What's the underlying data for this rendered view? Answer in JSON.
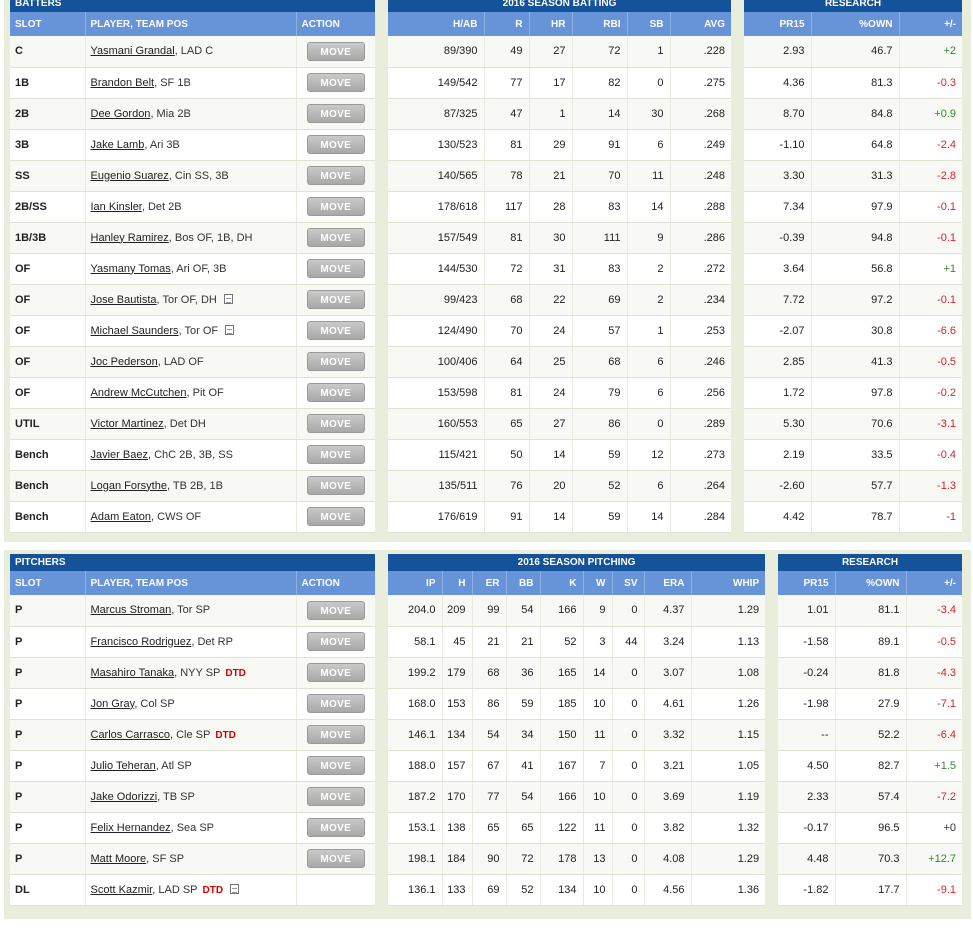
{
  "colors": {
    "caption_bg": "#14539a",
    "header_bg": "#6794d8",
    "positive": "#2e8b2e",
    "negative": "#d22222",
    "dtd": "#d40000"
  },
  "batters": {
    "section_title": "BATTERS",
    "stats_title": "2016 SEASON BATTING",
    "research_title": "RESEARCH",
    "headers": {
      "slot": "SLOT",
      "player": "PLAYER, TEAM POS",
      "action": "ACTION",
      "stats": [
        "H/AB",
        "R",
        "HR",
        "RBI",
        "SB",
        "AVG"
      ],
      "research": [
        "PR15",
        "%OWN",
        "+/-"
      ]
    },
    "rows": [
      {
        "slot": "C",
        "name": "Yasmani Grandal",
        "info": ", LAD C",
        "dtd": "",
        "note": false,
        "action": "MOVE",
        "stats": [
          "89/390",
          "49",
          "27",
          "72",
          "1",
          ".228"
        ],
        "research": [
          "2.93",
          "46.7",
          "+2"
        ],
        "trend": "pos"
      },
      {
        "slot": "1B",
        "name": "Brandon Belt",
        "info": ", SF 1B",
        "dtd": "",
        "note": false,
        "action": "MOVE",
        "stats": [
          "149/542",
          "77",
          "17",
          "82",
          "0",
          ".275"
        ],
        "research": [
          "4.36",
          "81.3",
          "-0.3"
        ],
        "trend": "neg"
      },
      {
        "slot": "2B",
        "name": "Dee Gordon",
        "info": ", Mia 2B",
        "dtd": "",
        "note": false,
        "action": "MOVE",
        "stats": [
          "87/325",
          "47",
          "1",
          "14",
          "30",
          ".268"
        ],
        "research": [
          "8.70",
          "84.8",
          "+0.9"
        ],
        "trend": "pos"
      },
      {
        "slot": "3B",
        "name": "Jake Lamb",
        "info": ", Ari 3B",
        "dtd": "",
        "note": false,
        "action": "MOVE",
        "stats": [
          "130/523",
          "81",
          "29",
          "91",
          "6",
          ".249"
        ],
        "research": [
          "-1.10",
          "64.8",
          "-2.4"
        ],
        "trend": "neg"
      },
      {
        "slot": "SS",
        "name": "Eugenio Suarez",
        "info": ", Cin SS, 3B",
        "dtd": "",
        "note": false,
        "action": "MOVE",
        "stats": [
          "140/565",
          "78",
          "21",
          "70",
          "11",
          ".248"
        ],
        "research": [
          "3.30",
          "31.3",
          "-2.8"
        ],
        "trend": "neg"
      },
      {
        "slot": "2B/SS",
        "name": "Ian Kinsler",
        "info": ", Det 2B",
        "dtd": "",
        "note": false,
        "action": "MOVE",
        "stats": [
          "178/618",
          "117",
          "28",
          "83",
          "14",
          ".288"
        ],
        "research": [
          "7.34",
          "97.9",
          "-0.1"
        ],
        "trend": "neg"
      },
      {
        "slot": "1B/3B",
        "name": "Hanley Ramirez",
        "info": ", Bos OF, 1B, DH",
        "dtd": "",
        "note": false,
        "action": "MOVE",
        "stats": [
          "157/549",
          "81",
          "30",
          "111",
          "9",
          ".286"
        ],
        "research": [
          "-0.39",
          "94.8",
          "-0.1"
        ],
        "trend": "neg"
      },
      {
        "slot": "OF",
        "name": "Yasmany Tomas",
        "info": ", Ari OF, 3B",
        "dtd": "",
        "note": false,
        "action": "MOVE",
        "stats": [
          "144/530",
          "72",
          "31",
          "83",
          "2",
          ".272"
        ],
        "research": [
          "3.64",
          "56.8",
          "+1"
        ],
        "trend": "pos"
      },
      {
        "slot": "OF",
        "name": "Jose Bautista",
        "info": ", Tor OF, DH",
        "dtd": "",
        "note": true,
        "action": "MOVE",
        "stats": [
          "99/423",
          "68",
          "22",
          "69",
          "2",
          ".234"
        ],
        "research": [
          "7.72",
          "97.2",
          "-0.1"
        ],
        "trend": "neg"
      },
      {
        "slot": "OF",
        "name": "Michael Saunders",
        "info": ", Tor OF",
        "dtd": "",
        "note": true,
        "action": "MOVE",
        "stats": [
          "124/490",
          "70",
          "24",
          "57",
          "1",
          ".253"
        ],
        "research": [
          "-2.07",
          "30.8",
          "-6.6"
        ],
        "trend": "neg"
      },
      {
        "slot": "OF",
        "name": "Joc Pederson",
        "info": ", LAD OF",
        "dtd": "",
        "note": false,
        "action": "MOVE",
        "stats": [
          "100/406",
          "64",
          "25",
          "68",
          "6",
          ".246"
        ],
        "research": [
          "2.85",
          "41.3",
          "-0.5"
        ],
        "trend": "neg"
      },
      {
        "slot": "OF",
        "name": "Andrew McCutchen",
        "info": ", Pit OF",
        "dtd": "",
        "note": false,
        "action": "MOVE",
        "stats": [
          "153/598",
          "81",
          "24",
          "79",
          "6",
          ".256"
        ],
        "research": [
          "1.72",
          "97.8",
          "-0.2"
        ],
        "trend": "neg"
      },
      {
        "slot": "UTIL",
        "name": "Victor Martinez",
        "info": ", Det DH",
        "dtd": "",
        "note": false,
        "action": "MOVE",
        "stats": [
          "160/553",
          "65",
          "27",
          "86",
          "0",
          ".289"
        ],
        "research": [
          "5.30",
          "70.6",
          "-3.1"
        ],
        "trend": "neg"
      },
      {
        "slot": "Bench",
        "name": "Javier Baez",
        "info": ", ChC 2B, 3B, SS",
        "dtd": "",
        "note": false,
        "action": "MOVE",
        "stats": [
          "115/421",
          "50",
          "14",
          "59",
          "12",
          ".273"
        ],
        "research": [
          "2.19",
          "33.5",
          "-0.4"
        ],
        "trend": "neg"
      },
      {
        "slot": "Bench",
        "name": "Logan Forsythe",
        "info": ", TB 2B, 1B",
        "dtd": "",
        "note": false,
        "action": "MOVE",
        "stats": [
          "135/511",
          "76",
          "20",
          "52",
          "6",
          ".264"
        ],
        "research": [
          "-2.60",
          "57.7",
          "-1.3"
        ],
        "trend": "neg"
      },
      {
        "slot": "Bench",
        "name": "Adam Eaton",
        "info": ", CWS OF",
        "dtd": "",
        "note": false,
        "action": "MOVE",
        "stats": [
          "176/619",
          "91",
          "14",
          "59",
          "14",
          ".284"
        ],
        "research": [
          "4.42",
          "78.7",
          "-1"
        ],
        "trend": "neg"
      }
    ]
  },
  "pitchers": {
    "section_title": "PITCHERS",
    "stats_title": "2016 SEASON PITCHING",
    "research_title": "RESEARCH",
    "headers": {
      "slot": "SLOT",
      "player": "PLAYER, TEAM POS",
      "action": "ACTION",
      "stats": [
        "IP",
        "H",
        "ER",
        "BB",
        "K",
        "W",
        "SV",
        "ERA",
        "WHIP"
      ],
      "research": [
        "PR15",
        "%OWN",
        "+/-"
      ]
    },
    "rows": [
      {
        "slot": "P",
        "name": "Marcus Stroman",
        "info": ", Tor SP",
        "dtd": "",
        "note": false,
        "action": "MOVE",
        "stats": [
          "204.0",
          "209",
          "99",
          "54",
          "166",
          "9",
          "0",
          "4.37",
          "1.29"
        ],
        "research": [
          "1.01",
          "81.1",
          "-3.4"
        ],
        "trend": "neg"
      },
      {
        "slot": "P",
        "name": "Francisco Rodriguez",
        "info": ", Det RP",
        "dtd": "",
        "note": false,
        "action": "MOVE",
        "stats": [
          "58.1",
          "45",
          "21",
          "21",
          "52",
          "3",
          "44",
          "3.24",
          "1.13"
        ],
        "research": [
          "-1.58",
          "89.1",
          "-0.5"
        ],
        "trend": "neg"
      },
      {
        "slot": "P",
        "name": "Masahiro Tanaka",
        "info": ", NYY SP",
        "dtd": "DTD",
        "note": false,
        "action": "MOVE",
        "stats": [
          "199.2",
          "179",
          "68",
          "36",
          "165",
          "14",
          "0",
          "3.07",
          "1.08"
        ],
        "research": [
          "-0.24",
          "81.8",
          "-4.3"
        ],
        "trend": "neg"
      },
      {
        "slot": "P",
        "name": "Jon Gray",
        "info": ", Col SP",
        "dtd": "",
        "note": false,
        "action": "MOVE",
        "stats": [
          "168.0",
          "153",
          "86",
          "59",
          "185",
          "10",
          "0",
          "4.61",
          "1.26"
        ],
        "research": [
          "-1.98",
          "27.9",
          "-7.1"
        ],
        "trend": "neg"
      },
      {
        "slot": "P",
        "name": "Carlos Carrasco",
        "info": ", Cle SP",
        "dtd": "DTD",
        "note": false,
        "action": "MOVE",
        "stats": [
          "146.1",
          "134",
          "54",
          "34",
          "150",
          "11",
          "0",
          "3.32",
          "1.15"
        ],
        "research": [
          "--",
          "52.2",
          "-6.4"
        ],
        "trend": "neg"
      },
      {
        "slot": "P",
        "name": "Julio Teheran",
        "info": ", Atl SP",
        "dtd": "",
        "note": false,
        "action": "MOVE",
        "stats": [
          "188.0",
          "157",
          "67",
          "41",
          "167",
          "7",
          "0",
          "3.21",
          "1.05"
        ],
        "research": [
          "4.50",
          "82.7",
          "+1.5"
        ],
        "trend": "pos"
      },
      {
        "slot": "P",
        "name": "Jake Odorizzi",
        "info": ", TB SP",
        "dtd": "",
        "note": false,
        "action": "MOVE",
        "stats": [
          "187.2",
          "170",
          "77",
          "54",
          "166",
          "10",
          "0",
          "3.69",
          "1.19"
        ],
        "research": [
          "2.33",
          "57.4",
          "-7.2"
        ],
        "trend": "neg"
      },
      {
        "slot": "P",
        "name": "Felix Hernandez",
        "info": ", Sea SP",
        "dtd": "",
        "note": false,
        "action": "MOVE",
        "stats": [
          "153.1",
          "138",
          "65",
          "65",
          "122",
          "11",
          "0",
          "3.82",
          "1.32"
        ],
        "research": [
          "-0.17",
          "96.5",
          "+0"
        ],
        "trend": "zero"
      },
      {
        "slot": "P",
        "name": "Matt Moore",
        "info": ", SF SP",
        "dtd": "",
        "note": false,
        "action": "MOVE",
        "stats": [
          "198.1",
          "184",
          "90",
          "72",
          "178",
          "13",
          "0",
          "4.08",
          "1.29"
        ],
        "research": [
          "4.48",
          "70.3",
          "+12.7"
        ],
        "trend": "pos"
      },
      {
        "slot": "DL",
        "name": "Scott Kazmir",
        "info": ", LAD SP",
        "dtd": "DTD",
        "note": true,
        "action": "",
        "stats": [
          "136.1",
          "133",
          "69",
          "52",
          "134",
          "10",
          "0",
          "4.56",
          "1.36"
        ],
        "research": [
          "-1.82",
          "17.7",
          "-9.1"
        ],
        "trend": "neg"
      }
    ]
  }
}
